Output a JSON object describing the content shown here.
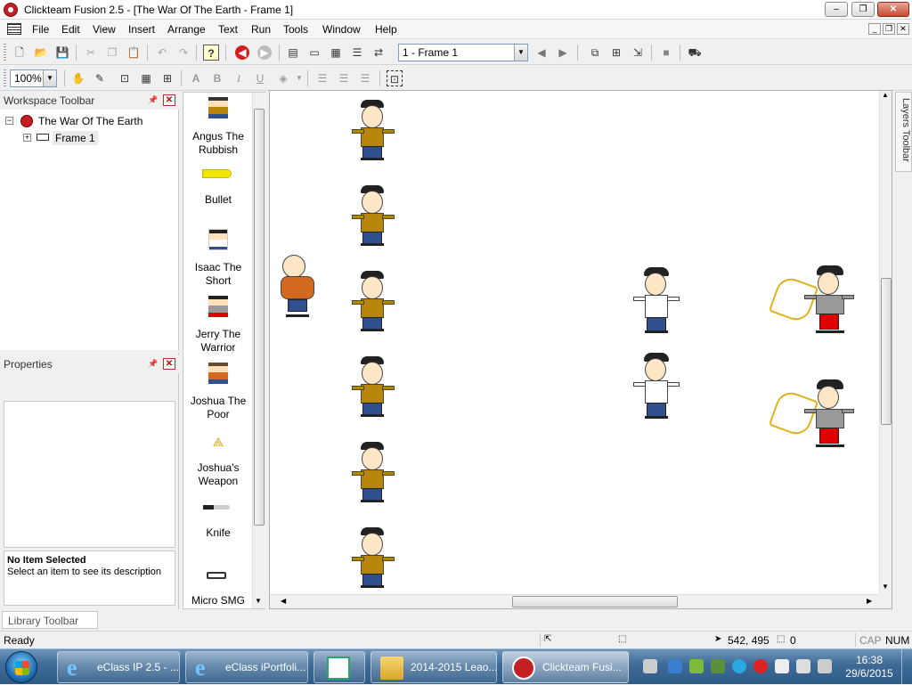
{
  "window": {
    "title": "Clickteam Fusion 2.5 - [The War Of The Earth - Frame 1]",
    "min": "–",
    "max": "❐",
    "close": "✕"
  },
  "menu": [
    "File",
    "Edit",
    "View",
    "Insert",
    "Arrange",
    "Text",
    "Run",
    "Tools",
    "Window",
    "Help"
  ],
  "toolbar": {
    "frame_select": "1 - Frame 1",
    "zoom": "100%"
  },
  "workspace": {
    "title": "Workspace Toolbar",
    "app_name": "The War Of The Earth",
    "frame_name": "Frame 1"
  },
  "properties": {
    "title": "Properties",
    "desc_title": "No Item Selected",
    "desc_text": "Select an item to see its description"
  },
  "library": {
    "tab": "Library Toolbar",
    "items": [
      "Angus The Rubbish",
      "Bullet",
      "Isaac The Short",
      "Jerry The Warrior",
      "Joshua The Poor",
      "Joshua's Weapon",
      "Knife",
      "Micro SMG"
    ]
  },
  "layers_toolbar": "Layers Toolbar",
  "status": {
    "ready": "Ready",
    "coords": "542, 495",
    "count": "0",
    "cap": "CAP",
    "num": "NUM"
  },
  "taskbar": {
    "items": [
      "eClass IP 2.5 - ...",
      "eClass iPortfoli...",
      "",
      "2014-2015 Leao...",
      "Clickteam Fusi..."
    ],
    "time": "16:38",
    "date": "29/6/2015"
  },
  "colors": {
    "angus_shirt": "#b8860b",
    "isaac_shirt": "#ffffff",
    "jerry_shirt": "#999999",
    "jerry_pants": "#e00000",
    "joshua_shirt": "#d2691e"
  }
}
